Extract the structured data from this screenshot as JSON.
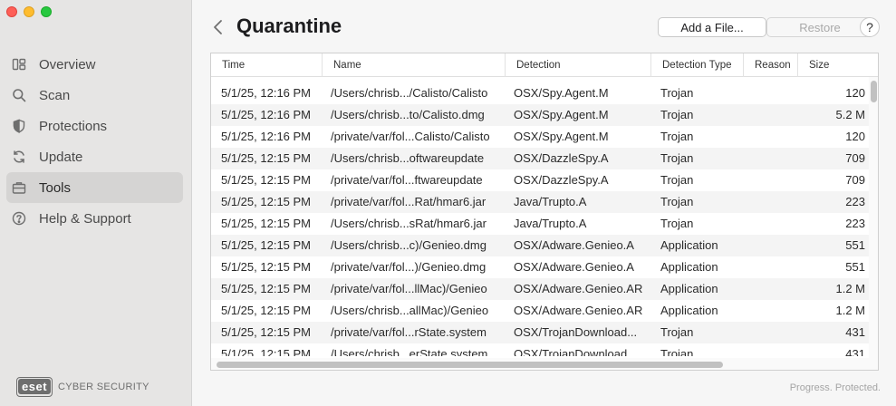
{
  "window": {
    "title": "Quarantine"
  },
  "sidebar": {
    "items": [
      {
        "label": "Overview",
        "icon": "overview-icon",
        "active": false
      },
      {
        "label": "Scan",
        "icon": "search-icon",
        "active": false
      },
      {
        "label": "Protections",
        "icon": "shield-icon",
        "active": false
      },
      {
        "label": "Update",
        "icon": "refresh-icon",
        "active": false
      },
      {
        "label": "Tools",
        "icon": "briefcase-icon",
        "active": true
      },
      {
        "label": "Help & Support",
        "icon": "help-icon",
        "active": false
      }
    ],
    "brand_logo": "eset",
    "brand_text": "CYBER SECURITY"
  },
  "toolbar": {
    "add_label": "Add a File...",
    "restore_label": "Restore",
    "help_label": "?"
  },
  "table": {
    "columns": [
      "Time",
      "Name",
      "Detection",
      "Detection Type",
      "Reason",
      "Size"
    ],
    "rows": [
      {
        "time": "5/1/25, 12:16 PM",
        "name": "/Users/chrisb.../Calisto/Calisto",
        "detection": "OSX/Spy.Agent.M",
        "type": "Trojan",
        "reason": "",
        "size": "120"
      },
      {
        "time": "5/1/25, 12:16 PM",
        "name": "/Users/chrisb...to/Calisto.dmg",
        "detection": "OSX/Spy.Agent.M",
        "type": "Trojan",
        "reason": "",
        "size": "5.2 M"
      },
      {
        "time": "5/1/25, 12:16 PM",
        "name": "/private/var/fol...Calisto/Calisto",
        "detection": "OSX/Spy.Agent.M",
        "type": "Trojan",
        "reason": "",
        "size": "120"
      },
      {
        "time": "5/1/25, 12:15 PM",
        "name": "/Users/chrisb...oftwareupdate",
        "detection": "OSX/DazzleSpy.A",
        "type": "Trojan",
        "reason": "",
        "size": "709"
      },
      {
        "time": "5/1/25, 12:15 PM",
        "name": "/private/var/fol...ftwareupdate",
        "detection": "OSX/DazzleSpy.A",
        "type": "Trojan",
        "reason": "",
        "size": "709"
      },
      {
        "time": "5/1/25, 12:15 PM",
        "name": "/private/var/fol...Rat/hmar6.jar",
        "detection": "Java/Trupto.A",
        "type": "Trojan",
        "reason": "",
        "size": "223"
      },
      {
        "time": "5/1/25, 12:15 PM",
        "name": "/Users/chrisb...sRat/hmar6.jar",
        "detection": "Java/Trupto.A",
        "type": "Trojan",
        "reason": "",
        "size": "223"
      },
      {
        "time": "5/1/25, 12:15 PM",
        "name": "/Users/chrisb...c)/Genieo.dmg",
        "detection": "OSX/Adware.Genieo.A",
        "type": "Application",
        "reason": "",
        "size": "551"
      },
      {
        "time": "5/1/25, 12:15 PM",
        "name": "/private/var/fol...)/Genieo.dmg",
        "detection": "OSX/Adware.Genieo.A",
        "type": "Application",
        "reason": "",
        "size": "551"
      },
      {
        "time": "5/1/25, 12:15 PM",
        "name": "/private/var/fol...llMac)/Genieo",
        "detection": "OSX/Adware.Genieo.AR",
        "type": "Application",
        "reason": "",
        "size": "1.2 M"
      },
      {
        "time": "5/1/25, 12:15 PM",
        "name": "/Users/chrisb...allMac)/Genieo",
        "detection": "OSX/Adware.Genieo.AR",
        "type": "Application",
        "reason": "",
        "size": "1.2 M"
      },
      {
        "time": "5/1/25, 12:15 PM",
        "name": "/private/var/fol...rState.system",
        "detection": "OSX/TrojanDownload...",
        "type": "Trojan",
        "reason": "",
        "size": "431"
      },
      {
        "time": "5/1/25, 12:15 PM",
        "name": "/Users/chrisb...erState.system",
        "detection": "OSX/TrojanDownload...",
        "type": "Trojan",
        "reason": "",
        "size": "431"
      }
    ]
  },
  "footer": {
    "tagline": "Progress. Protected."
  }
}
